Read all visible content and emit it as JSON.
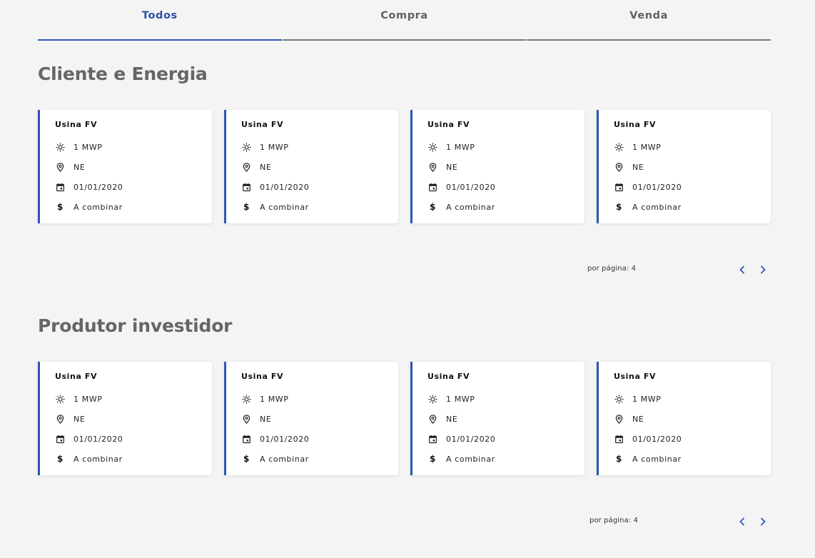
{
  "tabs": [
    {
      "label": "Todos",
      "active": true
    },
    {
      "label": "Compra",
      "active": false
    },
    {
      "label": "Venda",
      "active": false
    }
  ],
  "accent_color": "#2e55b8",
  "sections": [
    {
      "title": "Cliente e Energia",
      "cards": [
        {
          "title": "Usina FV",
          "power": "1 MWP",
          "region": "NE",
          "date": "01/01/2020",
          "price": "A combinar"
        },
        {
          "title": "Usina FV",
          "power": "1 MWP",
          "region": "NE",
          "date": "01/01/2020",
          "price": "A combinar"
        },
        {
          "title": "Usina FV",
          "power": "1 MWP",
          "region": "NE",
          "date": "01/01/2020",
          "price": "A combinar"
        },
        {
          "title": "Usina FV",
          "power": "1 MWP",
          "region": "NE",
          "date": "01/01/2020",
          "price": "A combinar"
        }
      ],
      "pagination": {
        "per_page_label": "por página: 4"
      }
    },
    {
      "title": "Produtor investidor",
      "cards": [
        {
          "title": "Usina FV",
          "power": "1 MWP",
          "region": "NE",
          "date": "01/01/2020",
          "price": "A combinar"
        },
        {
          "title": "Usina FV",
          "power": "1 MWP",
          "region": "NE",
          "date": "01/01/2020",
          "price": "A combinar"
        },
        {
          "title": "Usina FV",
          "power": "1 MWP",
          "region": "NE",
          "date": "01/01/2020",
          "price": "A combinar"
        },
        {
          "title": "Usina FV",
          "power": "1 MWP",
          "region": "NE",
          "date": "01/01/2020",
          "price": "A combinar"
        }
      ],
      "pagination": {
        "per_page_label": "por página: 4"
      }
    }
  ],
  "icons": {
    "power": "sun-icon",
    "region": "location-pin-icon",
    "date": "calendar-icon",
    "price": "dollar-icon",
    "prev": "chevron-left-icon",
    "next": "chevron-right-icon"
  },
  "price_symbol": "$"
}
